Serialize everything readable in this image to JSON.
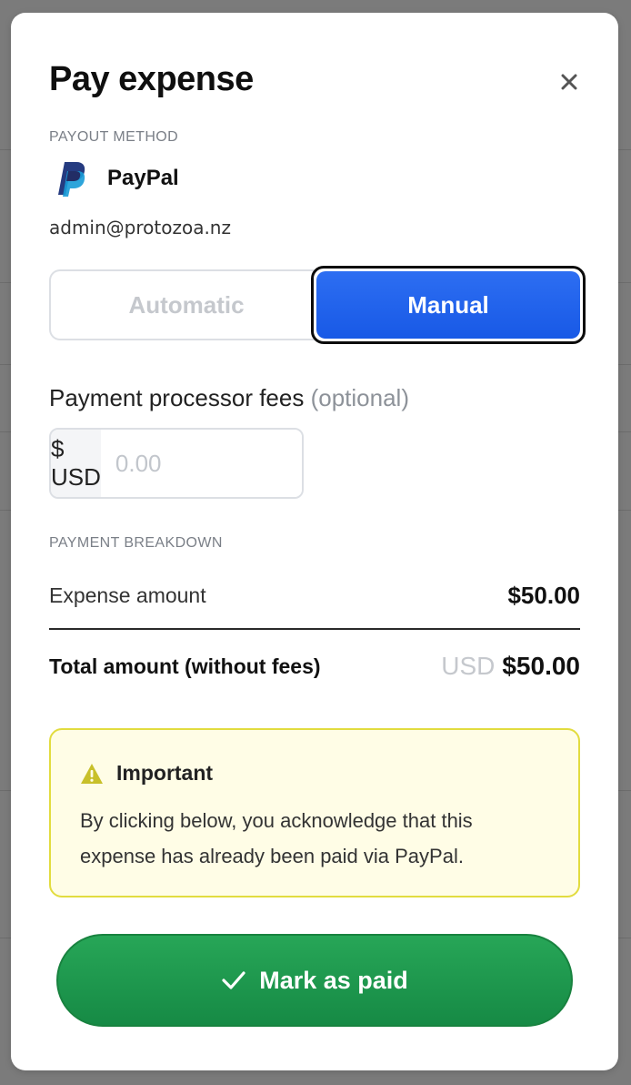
{
  "dialog": {
    "title": "Pay expense",
    "close_label": "×"
  },
  "payout": {
    "section_label": "PAYOUT METHOD",
    "method_name": "PayPal",
    "email": "admin@protozoa.nz",
    "icon": "paypal-logo-icon"
  },
  "mode_toggle": {
    "automatic_label": "Automatic",
    "manual_label": "Manual",
    "selected": "Manual"
  },
  "fees": {
    "label": "Payment processor fees",
    "optional_label": "(optional)",
    "currency_prefix": "$ USD",
    "placeholder": "0.00",
    "value": ""
  },
  "breakdown": {
    "section_label": "PAYMENT BREAKDOWN",
    "expense_label": "Expense amount",
    "expense_value": "$50.00",
    "total_label": "Total amount (without fees)",
    "total_currency": "USD",
    "total_value": "$50.00"
  },
  "notice": {
    "icon": "warning-icon",
    "title": "Important",
    "body": "By clicking below, you acknowledge that this expense has already been paid via PayPal."
  },
  "action": {
    "icon": "check-icon",
    "label": "Mark as paid"
  },
  "colors": {
    "primary_blue": "#1859e6",
    "success_green": "#1e9a4e",
    "notice_bg": "#fffde6",
    "notice_border": "#e2dc3f",
    "paypal_dark": "#253b80",
    "paypal_light": "#179bd7"
  }
}
